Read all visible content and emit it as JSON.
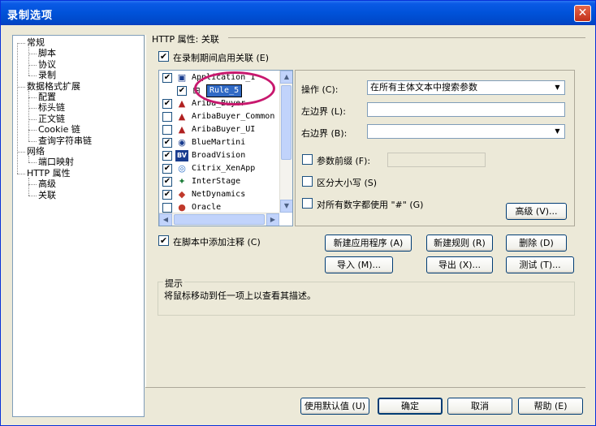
{
  "window": {
    "title": "录制选项",
    "close_symbol": "✕"
  },
  "tree": {
    "items": [
      {
        "label": "常规",
        "level": 0
      },
      {
        "label": "脚本",
        "level": 1
      },
      {
        "label": "协议",
        "level": 1
      },
      {
        "label": "录制",
        "level": 1
      },
      {
        "label": "数据格式扩展",
        "level": 0
      },
      {
        "label": "配置",
        "level": 1
      },
      {
        "label": "标头链",
        "level": 1
      },
      {
        "label": "正文链",
        "level": 1
      },
      {
        "label": "Cookie 链",
        "level": 1
      },
      {
        "label": "查询字符串链",
        "level": 1
      },
      {
        "label": "网络",
        "level": 0
      },
      {
        "label": "端口映射",
        "level": 1
      },
      {
        "label": "HTTP 属性",
        "level": 0
      },
      {
        "label": "高级",
        "level": 1
      },
      {
        "label": "关联",
        "level": 1
      }
    ]
  },
  "section": {
    "title": "HTTP 属性: 关联",
    "enable_correlation_label": "在录制期间启用关联 (E)",
    "enable_correlation_checked": true
  },
  "applications": {
    "rows": [
      {
        "label": "Application_1",
        "checked": true,
        "icon": "app-icon"
      },
      {
        "label": "Rule_5",
        "checked": true,
        "icon": "rule-icon",
        "editing": true
      },
      {
        "label": "Ariba_Buyer",
        "checked": true,
        "icon": "ariba-icon"
      },
      {
        "label": "AribaBuyer_Common",
        "checked": false,
        "icon": "ariba-icon"
      },
      {
        "label": "AribaBuyer_UI",
        "checked": false,
        "icon": "ariba-icon"
      },
      {
        "label": "BlueMartini",
        "checked": true,
        "icon": "bluemartini-icon"
      },
      {
        "label": "BroadVision",
        "checked": true,
        "icon": "broadvision-icon"
      },
      {
        "label": "Citrix_XenApp",
        "checked": true,
        "icon": "citrix-icon"
      },
      {
        "label": "InterStage",
        "checked": true,
        "icon": "interstage-icon"
      },
      {
        "label": "NetDynamics",
        "checked": true,
        "icon": "netdynamics-icon"
      },
      {
        "label": "Oracle",
        "checked": false,
        "icon": "oracle-icon"
      }
    ],
    "icon_glyphs": {
      "app-icon": "▣",
      "rule-icon": "⊞",
      "ariba-icon": "▲",
      "bluemartini-icon": "◉",
      "broadvision-icon": "BV",
      "citrix-icon": "◎",
      "interstage-icon": "✦",
      "netdynamics-icon": "◆",
      "oracle-icon": "●"
    }
  },
  "props": {
    "operation_label": "操作 (C):",
    "operation_value": "在所有主体文本中搜索参数",
    "left_boundary_label": "左边界 (L):",
    "right_boundary_label": "右边界 (B):",
    "param_prefix_label": "参数前缀 (F):",
    "param_prefix_checked": false,
    "case_sensitive_label": "区分大小写 (S)",
    "case_sensitive_checked": false,
    "use_hash_label": "对所有数字都使用 \"#\" (G)",
    "use_hash_checked": false,
    "advanced_button": "高级 (V)..."
  },
  "add_comment": {
    "label": "在脚本中添加注释 (C)",
    "checked": true
  },
  "actions": {
    "new_app": "新建应用程序 (A)",
    "new_rule": "新建规则 (R)",
    "delete": "删除 (D)",
    "import": "导入 (M)...",
    "export": "导出 (X)...",
    "test": "测试 (T)..."
  },
  "hint": {
    "title": "提示",
    "text": "将鼠标移动到任一项上以查看其描述。"
  },
  "footer": {
    "defaults": "使用默认值 (U)",
    "ok": "确定",
    "cancel": "取消",
    "help": "帮助 (E)"
  },
  "colors": {
    "title_bar": "#0052d9",
    "highlight_ellipse": "#c8186e",
    "selection": "#316ac5"
  }
}
